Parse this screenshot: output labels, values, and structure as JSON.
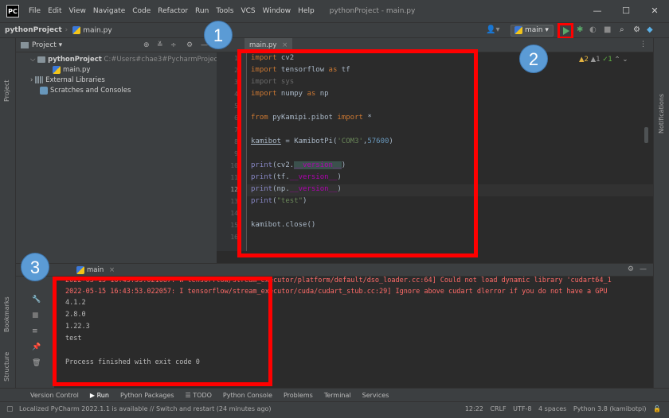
{
  "window": {
    "logo": "PC",
    "menu": [
      "File",
      "Edit",
      "View",
      "Navigate",
      "Code",
      "Refactor",
      "Run",
      "Tools",
      "VCS",
      "Window",
      "Help"
    ],
    "title": "pythonProject - main.py",
    "controls": [
      "—",
      "☐",
      "✕"
    ]
  },
  "navbar": {
    "project": "pythonProject",
    "file": "main.py",
    "run_config": "main ▾"
  },
  "project_panel": {
    "header": "Project ▾",
    "root_label": "pythonProject",
    "root_path": "C:#Users#chae3#PycharmProjects#pyth",
    "file": "main.py",
    "external_libs": "External Libraries",
    "scratches": "Scratches and Consoles"
  },
  "left_strip": {
    "project": "Project",
    "bookmarks": "Bookmarks",
    "structure": "Structure"
  },
  "right_strip": {
    "notifications": "Notifications"
  },
  "editor": {
    "tab": "main.py",
    "inspections": {
      "warnings": "▲2",
      "weak": "▲1",
      "ok": "✓1"
    },
    "line_numbers": [
      "1",
      "2",
      "3",
      "4",
      "5",
      "6",
      "7",
      "8",
      "9",
      "10",
      "11",
      "12",
      "13",
      "14",
      "15",
      "16"
    ],
    "current_line": 12
  },
  "run_panel": {
    "tab": "main",
    "console": [
      {
        "type": "err",
        "text": "2022-05-15 16:43:53.021087: W tensorflow/stream_executor/platform/default/dso_loader.cc:64] Could not load dynamic library 'cudart64_1"
      },
      {
        "type": "err",
        "text": "2022-05-15 16:43:53.022057: I tensorflow/stream_executor/cuda/cudart_stub.cc:29] Ignore above cudart dlerror if you do not have a GPU"
      },
      {
        "type": "out",
        "text": "4.1.2"
      },
      {
        "type": "out",
        "text": "2.8.0"
      },
      {
        "type": "out",
        "text": "1.22.3"
      },
      {
        "type": "out",
        "text": "test"
      },
      {
        "type": "out",
        "text": ""
      },
      {
        "type": "out",
        "text": "Process finished with exit code 0"
      }
    ]
  },
  "tool_windows": [
    "Version Control",
    "▶ Run",
    "Python Packages",
    "☰ TODO",
    "Python Console",
    "Problems",
    "Terminal",
    "Services"
  ],
  "status": {
    "message": "Localized PyCharm 2022.1.1 is available // Switch and restart (24 minutes ago)",
    "position": "12:22",
    "line_sep": "CRLF",
    "encoding": "UTF-8",
    "indent": "4 spaces",
    "interpreter": "Python 3.8 (kamibotpi)"
  },
  "callouts": [
    "1",
    "2",
    "3"
  ],
  "colors": {
    "highlight": "#ff0000",
    "callout": "#5b9bd5",
    "run": "#59a869"
  }
}
